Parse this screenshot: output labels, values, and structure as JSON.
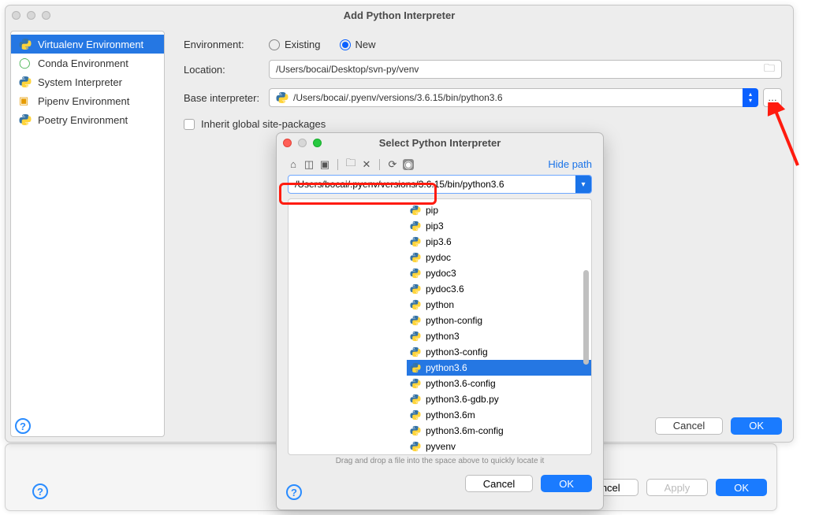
{
  "mainWindow": {
    "title": "Add Python Interpreter",
    "sidebar": {
      "items": [
        {
          "label": "Virtualenv Environment"
        },
        {
          "label": "Conda Environment"
        },
        {
          "label": "System Interpreter"
        },
        {
          "label": "Pipenv Environment"
        },
        {
          "label": "Poetry Environment"
        }
      ]
    },
    "form": {
      "environmentLabel": "Environment:",
      "existingLabel": "Existing",
      "newLabel": "New",
      "locationLabel": "Location:",
      "locationValue": "/Users/bocai/Desktop/svn-py/venv",
      "baseLabel": "Base interpreter:",
      "baseValue": "/Users/bocai/.pyenv/versions/3.6.15/bin/python3.6",
      "inheritLabel": "Inherit global site-packages"
    },
    "buttons": {
      "cancel": "Cancel",
      "ok": "OK"
    }
  },
  "selectDialog": {
    "title": "Select Python Interpreter",
    "hidePath": "Hide path",
    "pathValue": "/Users/bocai/.pyenv/versions/3.6.15/bin/python3.6",
    "files": [
      "pip",
      "pip3",
      "pip3.6",
      "pydoc",
      "pydoc3",
      "pydoc3.6",
      "python",
      "python-config",
      "python3",
      "python3-config",
      "python3.6",
      "python3.6-config",
      "python3.6-gdb.py",
      "python3.6m",
      "python3.6m-config",
      "pyvenv"
    ],
    "selectedFile": "python3.6",
    "dragHint": "Drag and drop a file into the space above to quickly locate it",
    "buttons": {
      "cancel": "Cancel",
      "ok": "OK"
    }
  },
  "prefWindow": {
    "buttons": {
      "cancel": "Cancel",
      "apply": "Apply",
      "ok": "OK"
    }
  }
}
